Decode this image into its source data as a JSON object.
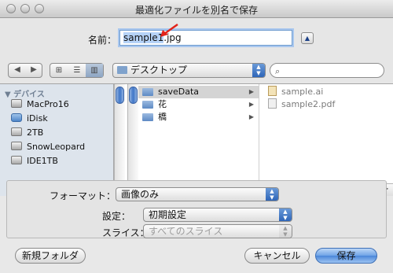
{
  "window": {
    "title": "最適化ファイルを別名で保存"
  },
  "name_field": {
    "label": "名前：",
    "selected": "sample1",
    "suffix": ".jpg"
  },
  "toolbar": {
    "back": "◀",
    "forward": "▶",
    "location": "デスクトップ"
  },
  "sidebar": {
    "header": "▼ デバイス",
    "items": [
      {
        "label": "MacPro16",
        "icon": "hard-drive-icon"
      },
      {
        "label": "iDisk",
        "icon": "idisk-icon"
      },
      {
        "label": "2TB",
        "icon": "hard-drive-icon"
      },
      {
        "label": "SnowLeopard",
        "icon": "hard-drive-icon"
      },
      {
        "label": "IDE1TB",
        "icon": "hard-drive-icon"
      }
    ]
  },
  "column1": {
    "items": [
      {
        "label": "saveData",
        "selected": true
      },
      {
        "label": "花",
        "selected": false
      },
      {
        "label": "橋",
        "selected": false
      }
    ]
  },
  "column2": {
    "items": [
      {
        "label": "sample.ai"
      },
      {
        "label": "sample2.pdf"
      }
    ]
  },
  "options": {
    "format_label": "フォーマット：",
    "format_value": "画像のみ",
    "settings_label": "設定：",
    "settings_value": "初期設定",
    "slices_label": "スライス：",
    "slices_value": "すべてのスライス"
  },
  "buttons": {
    "new_folder": "新規フォルダ",
    "cancel": "キャンセル",
    "save": "保存"
  },
  "colors": {
    "accent": "#3f76c8",
    "annotation_arrow": "#e2231a"
  }
}
